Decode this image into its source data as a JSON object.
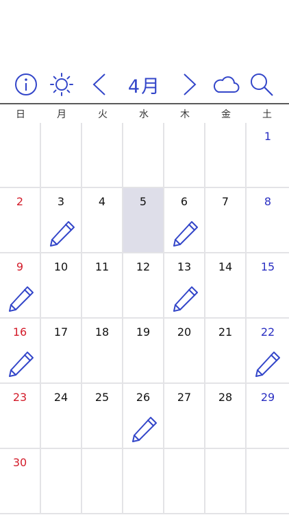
{
  "toolbar": {
    "month_title": "4月",
    "icons": [
      "info-icon",
      "sun-icon",
      "chevron-left-icon",
      "chevron-right-icon",
      "cloud-icon",
      "search-icon"
    ]
  },
  "weekdays": [
    "日",
    "月",
    "火",
    "水",
    "木",
    "金",
    "土"
  ],
  "calendar": {
    "today": "5",
    "memo_days": [
      "3",
      "6",
      "9",
      "13",
      "16",
      "22",
      "26"
    ],
    "colors": {
      "accent": "#3346c9",
      "sunday": "#d31c2a",
      "saturday": "#2a2fc2",
      "today_bg": "#dedee9"
    },
    "weeks": [
      [
        "",
        "",
        "",
        "",
        "",
        "",
        "1"
      ],
      [
        "2",
        "3",
        "4",
        "5",
        "6",
        "7",
        "8"
      ],
      [
        "9",
        "10",
        "11",
        "12",
        "13",
        "14",
        "15"
      ],
      [
        "16",
        "17",
        "18",
        "19",
        "20",
        "21",
        "22"
      ],
      [
        "23",
        "24",
        "25",
        "26",
        "27",
        "28",
        "29"
      ],
      [
        "30",
        "",
        "",
        "",
        "",
        "",
        ""
      ]
    ]
  }
}
